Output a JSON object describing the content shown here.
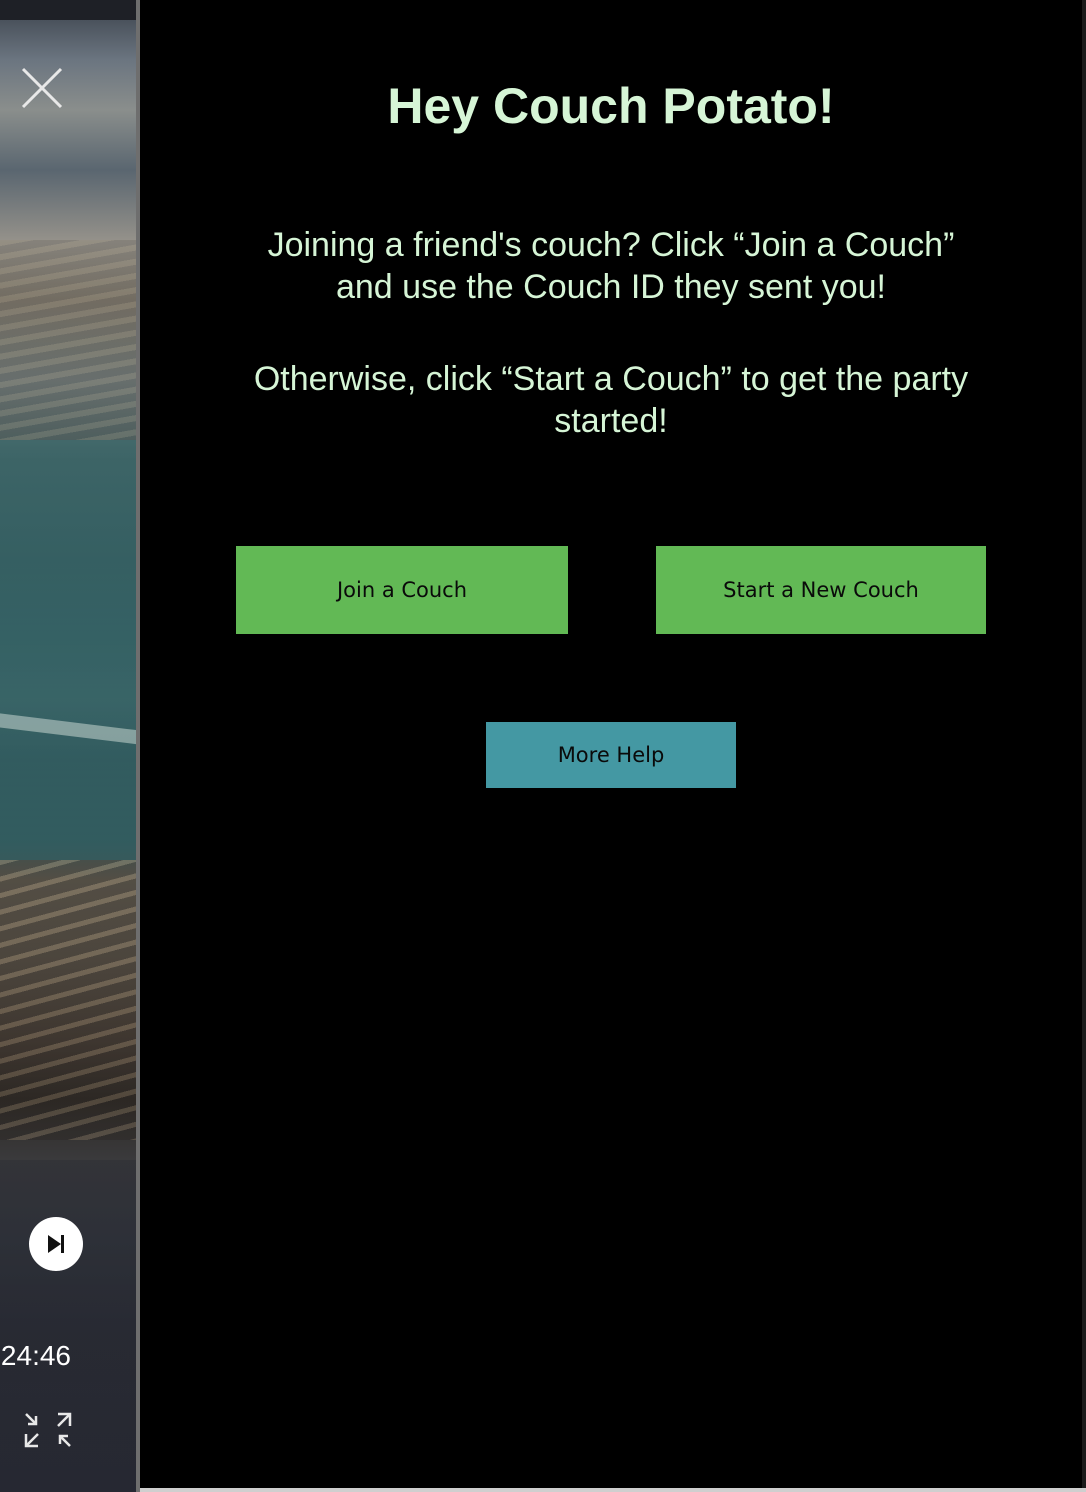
{
  "player": {
    "time_readout": "24:46",
    "icons": {
      "close": "close-icon",
      "skip": "skip-next-icon",
      "fullscreen": "fullscreen-icon"
    }
  },
  "panel": {
    "title": "Hey Couch Potato!",
    "instructions": [
      "Joining a friend's couch? Click “Join a Couch” and use the Couch ID they sent you!",
      "Otherwise, click “Start a Couch” to get the party started!"
    ],
    "buttons": {
      "join_label": "Join a Couch",
      "start_label": "Start a New Couch",
      "help_label": "More Help"
    },
    "colors": {
      "text": "#d6f5d6",
      "primary_button": "#62b955",
      "help_button": "#4498a3",
      "background": "#000000"
    }
  }
}
